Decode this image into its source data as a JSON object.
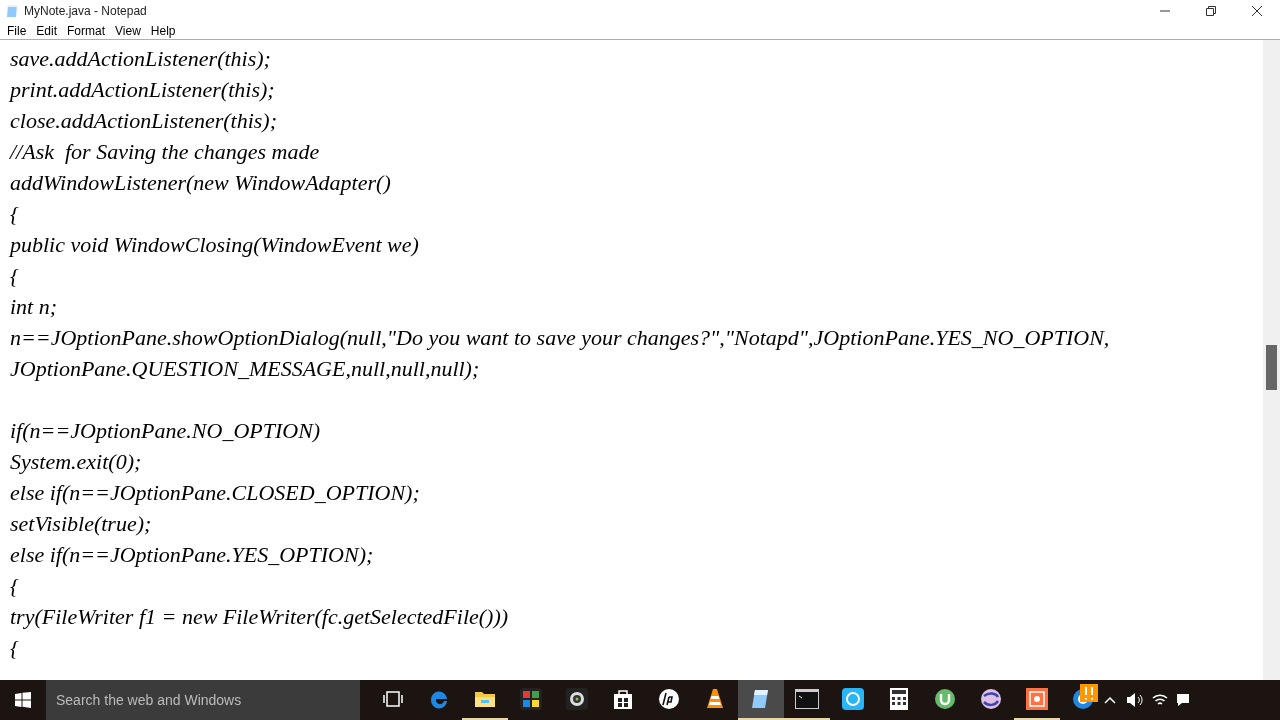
{
  "window": {
    "title": "MyNote.java - Notepad"
  },
  "menu": [
    "File",
    "Edit",
    "Format",
    "View",
    "Help"
  ],
  "editor": {
    "blocks": [
      [
        "save.addActionListener(this);",
        "print.addActionListener(this);",
        "close.addActionListener(this);",
        "//Ask  for Saving the changes made",
        "addWindowListener(new WindowAdapter()",
        "{",
        "public void WindowClosing(WindowEvent we)",
        "{",
        "int n;",
        "n==JOptionPane.showOptionDialog(null,\"Do you want to save your changes?\",\"Notapd\",JOptionPane.YES_NO_OPTION,",
        "JOptionPane.QUESTION_MESSAGE,null,null,null);"
      ],
      [
        "if(n==JOptionPane.NO_OPTION)",
        "System.exit(0);",
        "else if(n==JOptionPane.CLOSED_OPTION);",
        "setVisible(true);",
        "else if(n==JOptionPane.YES_OPTION);",
        "{",
        "try(FileWriter f1 = new FileWriter(fc.getSelectedFile()))",
        "{"
      ]
    ]
  },
  "taskbar": {
    "search": {
      "placeholder": "Search the web and Windows"
    },
    "apps": [
      {
        "kind": "taskview",
        "running": false,
        "selected": false
      },
      {
        "kind": "edge",
        "running": false,
        "selected": false
      },
      {
        "kind": "folder",
        "running": true,
        "selected": false
      },
      {
        "kind": "puzzle",
        "running": false,
        "selected": false
      },
      {
        "kind": "camera",
        "running": false,
        "selected": false
      },
      {
        "kind": "store",
        "running": false,
        "selected": false
      },
      {
        "kind": "hp",
        "running": false,
        "selected": false
      },
      {
        "kind": "cone",
        "running": false,
        "selected": false
      },
      {
        "kind": "notepad",
        "running": true,
        "selected": true
      },
      {
        "kind": "terminal",
        "running": true,
        "selected": false
      },
      {
        "kind": "share",
        "running": false,
        "selected": false
      },
      {
        "kind": "calculator",
        "running": false,
        "selected": false
      },
      {
        "kind": "torrent",
        "running": false,
        "selected": false
      },
      {
        "kind": "sphere",
        "running": false,
        "selected": false
      },
      {
        "kind": "paint",
        "running": true,
        "selected": false
      },
      {
        "kind": "globe",
        "running": false,
        "selected": false
      }
    ]
  }
}
